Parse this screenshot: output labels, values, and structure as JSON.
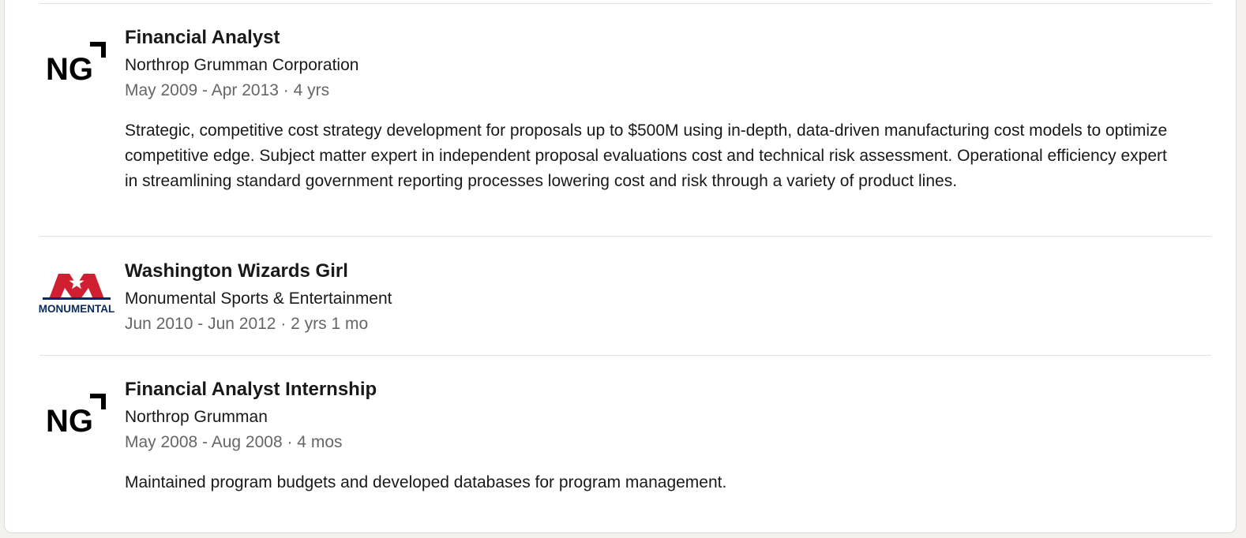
{
  "experience": [
    {
      "logo": "northrop-grumman-logo",
      "logo_text": "NG",
      "title": "Financial Analyst",
      "company": "Northrop Grumman Corporation",
      "dates": "May 2009 - Apr 2013 · 4 yrs",
      "description": "Strategic, competitive cost strategy development for proposals up to $500M using in-depth, data-driven manufacturing cost models to optimize competitive edge. Subject matter expert in independent proposal evaluations cost and technical risk assessment. Operational efficiency expert in streamlining standard government reporting processes lowering cost and risk through a variety of product lines."
    },
    {
      "logo": "monumental-logo",
      "logo_text": "MONUMENTAL",
      "title": "Washington Wizards Girl",
      "company": "Monumental Sports & Entertainment",
      "dates": "Jun 2010 - Jun 2012 · 2 yrs 1 mo",
      "description": ""
    },
    {
      "logo": "northrop-grumman-logo",
      "logo_text": "NG",
      "title": "Financial Analyst Internship",
      "company": "Northrop Grumman",
      "dates": "May 2008 - Aug 2008 · 4 mos",
      "description": "Maintained program budgets and developed databases for program management."
    }
  ],
  "colors": {
    "monumental_red": "#d01f31",
    "monumental_navy": "#0b2a5b",
    "muted_text": "#666666"
  }
}
